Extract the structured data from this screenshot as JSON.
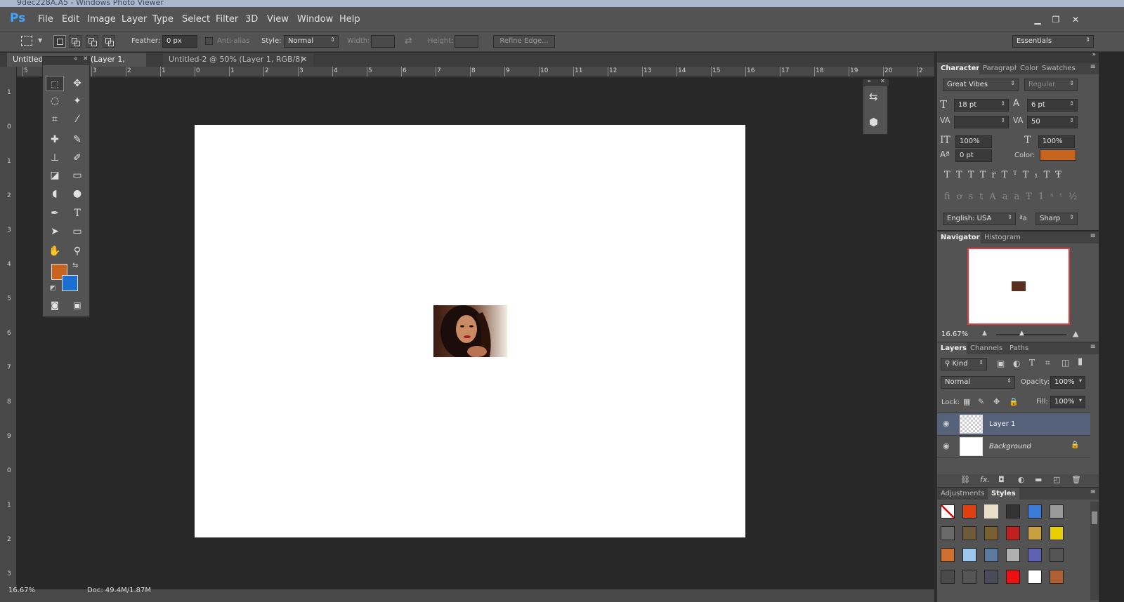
{
  "window": {
    "title": "9dec228A.A5 - Windows Photo Viewer"
  },
  "app": {
    "logo": "Ps"
  },
  "menu": [
    "File",
    "Edit",
    "Image",
    "Layer",
    "Type",
    "Select",
    "Filter",
    "3D",
    "View",
    "Window",
    "Help"
  ],
  "window_controls": {
    "minimize": "▁",
    "restore": "❐",
    "close": "✕"
  },
  "options": {
    "feather_label": "Feather:",
    "feather_value": "0 px",
    "antialias_label": "Anti-alias",
    "style_label": "Style:",
    "style_value": "Normal",
    "width_label": "Width:",
    "height_label": "Height:",
    "refine_edge": "Refine Edge...",
    "workspace": "Essentials"
  },
  "tabs": [
    {
      "label": "Untitled-1 @ 16.7% (Layer 1, RGB/8) *"
    },
    {
      "label": "Untitled-2 @ 50% (Layer 1, RGB/8) *"
    }
  ],
  "ruler": {
    "h": [
      "5",
      "4",
      "3",
      "2",
      "1",
      "0",
      "1",
      "2",
      "3",
      "4",
      "5",
      "6",
      "7",
      "8",
      "9",
      "10",
      "11",
      "12",
      "13",
      "14",
      "15",
      "16",
      "17",
      "18",
      "19",
      "20",
      "2"
    ],
    "v": [
      "1",
      "0",
      "1",
      "2",
      "3",
      "4",
      "5",
      "6",
      "7",
      "8",
      "9",
      "0",
      "1",
      "2",
      "3"
    ]
  },
  "colors": {
    "foreground": "#c8641e",
    "background": "#1a6fd0",
    "char_color": "#c8641e"
  },
  "character": {
    "tabs": [
      "Character",
      "Paragraph",
      "Color",
      "Swatches"
    ],
    "font": "Great Vibes",
    "font_style": "Regular",
    "size": "18 pt",
    "leading": "6 pt",
    "kerning": "",
    "tracking": "50",
    "vscale": "100%",
    "hscale": "100%",
    "baseline": "0 pt",
    "color_label": "Color:",
    "language": "English: USA",
    "aa_label": "a",
    "antialias": "Sharp"
  },
  "navigator": {
    "tabs": [
      "Navigator",
      "Histogram"
    ],
    "zoom": "16.67%"
  },
  "layers": {
    "tabs": [
      "Layers",
      "Channels",
      "Paths"
    ],
    "kind": "Kind",
    "blend": "Normal",
    "opacity_label": "Opacity:",
    "opacity": "100%",
    "lock_label": "Lock:",
    "fill_label": "Fill:",
    "fill": "100%",
    "items": [
      {
        "name": "Layer 1",
        "selected": true
      },
      {
        "name": "Background",
        "selected": false
      }
    ]
  },
  "styles_panel": {
    "tabs": [
      "Adjustments",
      "Styles"
    ]
  },
  "status": {
    "zoom": "16.67%",
    "doc": "Doc: 49.4M/1.87M"
  }
}
